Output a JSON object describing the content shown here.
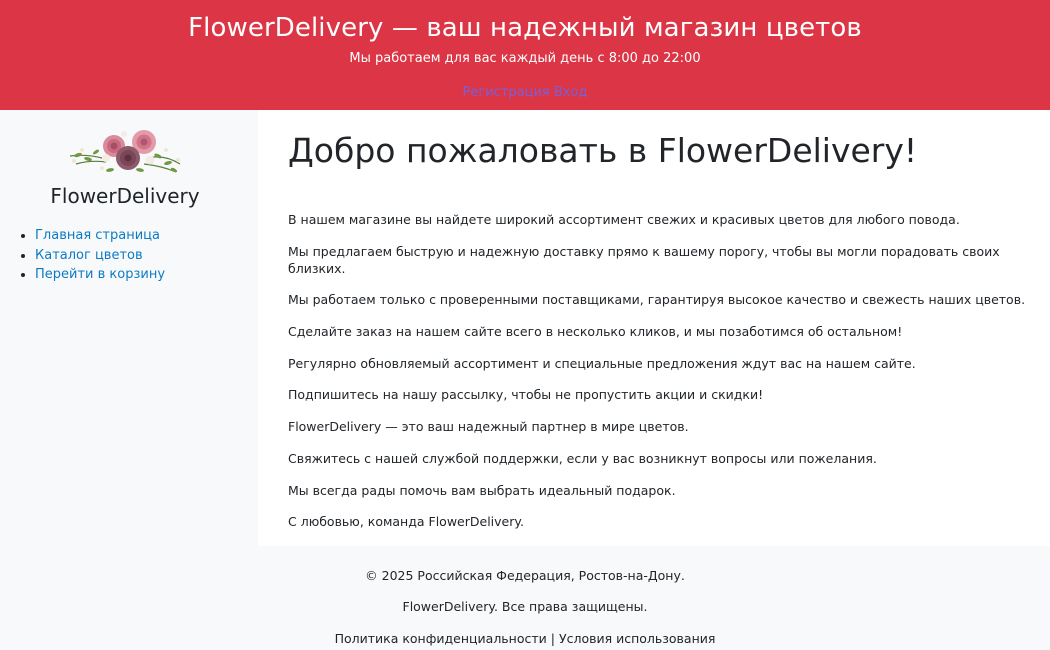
{
  "header": {
    "title": "FlowerDelivery — ваш надежный магазин цветов",
    "subtitle": "Мы работаем для вас каждый день с 8:00 до 22:00",
    "register_label": "Регистрация",
    "login_label": "Вход"
  },
  "sidebar": {
    "brand": "FlowerDelivery",
    "logo_icon": "flower-bouquet-icon",
    "nav": [
      {
        "label": "Главная страница"
      },
      {
        "label": "Каталог цветов"
      },
      {
        "label": "Перейти в корзину"
      }
    ]
  },
  "main": {
    "title": "Добро пожаловать в FlowerDelivery!",
    "paragraphs": [
      "В нашем магазине вы найдете широкий ассортимент свежих и красивых цветов для любого повода.",
      "Мы предлагаем быструю и надежную доставку прямо к вашему порогу, чтобы вы могли порадовать своих близких.",
      "Мы работаем только с проверенными поставщиками, гарантируя высокое качество и свежесть наших цветов.",
      "Сделайте заказ на нашем сайте всего в несколько кликов, и мы позаботимся об остальном!",
      "Регулярно обновляемый ассортимент и специальные предложения ждут вас на нашем сайте.",
      "Подпишитесь на нашу рассылку, чтобы не пропустить акции и скидки!",
      "FlowerDelivery — это ваш надежный партнер в мире цветов.",
      "Свяжитесь с нашей службой поддержки, если у вас возникнут вопросы или пожелания.",
      "Мы всегда рады помочь вам выбрать идеальный подарок.",
      "С любовью, команда FlowerDelivery."
    ]
  },
  "footer": {
    "copyright": "© 2025 Российская Федерация, Ростов-на-Дону.",
    "rights": "FlowerDelivery. Все права защищены.",
    "privacy_label": "Политика конфиденциальности",
    "separator": "|",
    "terms_label": "Условия использования"
  },
  "colors": {
    "header_bg": "#dc3545",
    "link": "#0d7bc4",
    "auth_link": "#7b5fd6"
  }
}
